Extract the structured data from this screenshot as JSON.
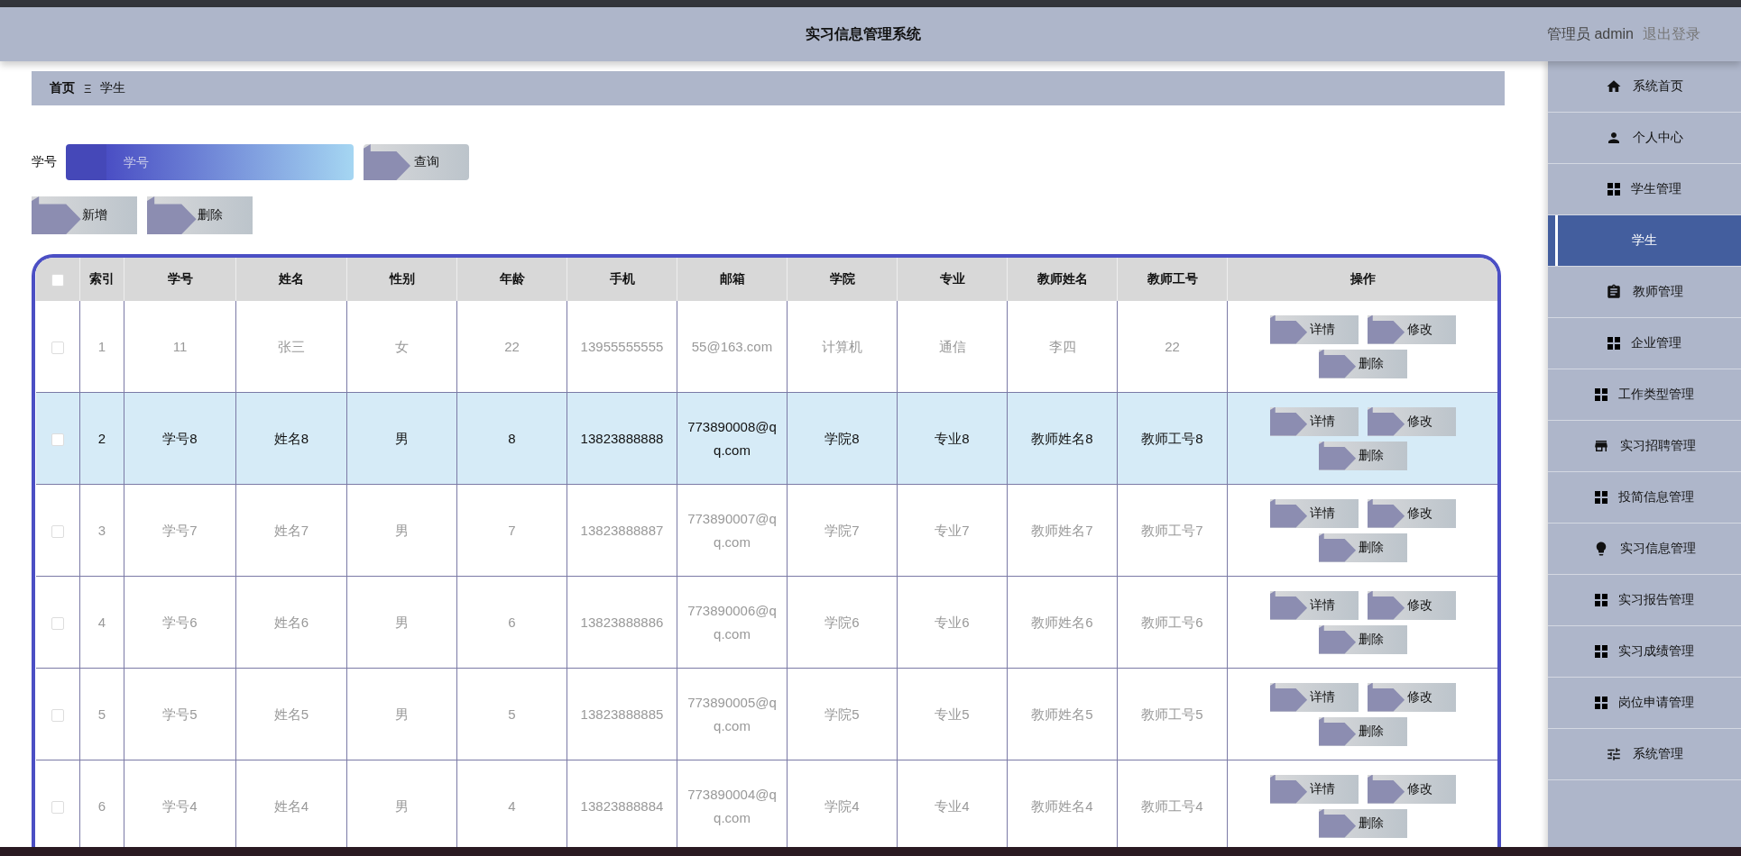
{
  "header": {
    "title": "实习信息管理系统",
    "user": "管理员 admin",
    "logout": "退出登录"
  },
  "sidebar": {
    "items": [
      {
        "label": "系统首页",
        "selected": false
      },
      {
        "label": "个人中心",
        "selected": false
      },
      {
        "label": "学生管理",
        "selected": false,
        "children": [
          {
            "label": "学生",
            "selected": true
          }
        ]
      },
      {
        "label": "教师管理",
        "selected": false
      },
      {
        "label": "企业管理",
        "selected": false
      },
      {
        "label": "工作类型管理",
        "selected": false
      },
      {
        "label": "实习招聘管理",
        "selected": false
      },
      {
        "label": "投简信息管理",
        "selected": false
      },
      {
        "label": "实习信息管理",
        "selected": false
      },
      {
        "label": "实习报告管理",
        "selected": false
      },
      {
        "label": "实习成绩管理",
        "selected": false
      },
      {
        "label": "岗位申请管理",
        "selected": false
      },
      {
        "label": "系统管理",
        "selected": false
      }
    ]
  },
  "breadcrumb": [
    "首页",
    "学生"
  ],
  "breadcrumb_separator": "Ξ",
  "search": {
    "label": "学号",
    "placeholder": "学号",
    "button": "查询"
  },
  "toolbar": [
    "新增",
    "删除"
  ],
  "table": {
    "select_all_checked": false,
    "columns": [
      "索引",
      "学号",
      "姓名",
      "性别",
      "年龄",
      "手机",
      "邮箱",
      "学院",
      "专业",
      "教师姓名",
      "教师工号",
      "操作"
    ],
    "rows": [
      {
        "checked": false,
        "selected": false,
        "actions": [
          "详情",
          "修改",
          "删除"
        ],
        "cells": [
          "1",
          "11",
          "张三",
          "女",
          "22",
          "13955555555",
          "55@163.com",
          "计算机",
          "通信",
          "李四",
          "22"
        ]
      },
      {
        "checked": false,
        "selected": true,
        "actions": [
          "详情",
          "修改",
          "删除"
        ],
        "cells": [
          "2",
          "学号8",
          "姓名8",
          "男",
          "8",
          "13823888888",
          "773890008@qq.com",
          "学院8",
          "专业8",
          "教师姓名8",
          "教师工号8"
        ]
      },
      {
        "checked": false,
        "selected": false,
        "actions": [
          "详情",
          "修改",
          "删除"
        ],
        "cells": [
          "3",
          "学号7",
          "姓名7",
          "男",
          "7",
          "13823888887",
          "773890007@qq.com",
          "学院7",
          "专业7",
          "教师姓名7",
          "教师工号7"
        ]
      },
      {
        "checked": false,
        "selected": false,
        "actions": [
          "详情",
          "修改",
          "删除"
        ],
        "cells": [
          "4",
          "学号6",
          "姓名6",
          "男",
          "6",
          "13823888886",
          "773890006@qq.com",
          "学院6",
          "专业6",
          "教师姓名6",
          "教师工号6"
        ]
      },
      {
        "checked": false,
        "selected": false,
        "actions": [
          "详情",
          "修改",
          "删除"
        ],
        "cells": [
          "5",
          "学号5",
          "姓名5",
          "男",
          "5",
          "13823888885",
          "773890005@qq.com",
          "学院5",
          "专业5",
          "教师姓名5",
          "教师工号5"
        ]
      },
      {
        "checked": false,
        "selected": false,
        "actions": [
          "详情",
          "修改",
          "删除"
        ],
        "cells": [
          "6",
          "学号4",
          "姓名4",
          "男",
          "4",
          "13823888884",
          "773890004@qq.com",
          "学院4",
          "专业4",
          "教师姓名4",
          "教师工号4"
        ]
      }
    ]
  }
}
